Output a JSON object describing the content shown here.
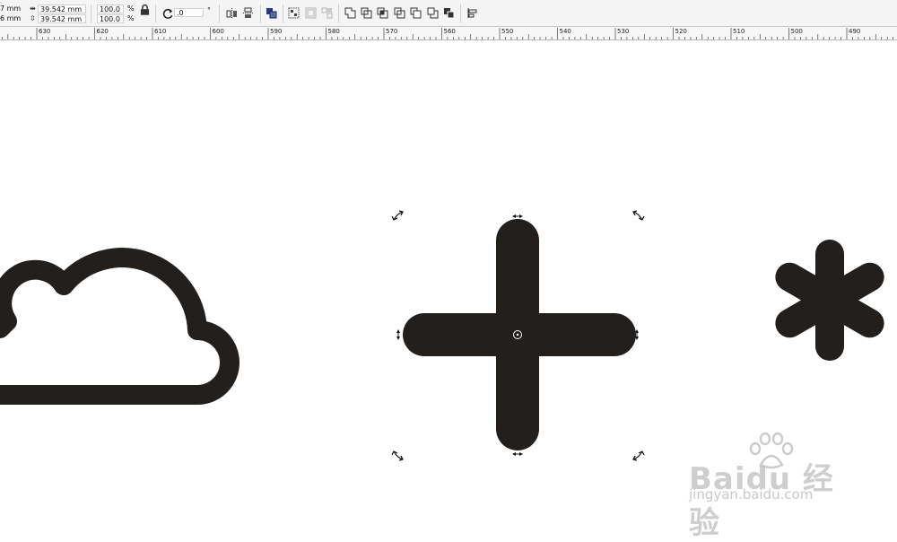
{
  "propbar": {
    "x_partial": "7 mm",
    "y_partial": "6 mm",
    "width_value": "39.542 mm",
    "height_value": "39.542 mm",
    "scale_x": "100.0",
    "scale_y": "100.0",
    "pct_symbol_1": "%",
    "pct_symbol_2": "%",
    "angle_value": ".0",
    "degree_symbol": "°"
  },
  "ruler": {
    "labels": [
      "630",
      "620",
      "610",
      "600",
      "590",
      "580",
      "570",
      "560",
      "550",
      "540",
      "530",
      "520",
      "510",
      "500",
      "490"
    ]
  },
  "watermark": {
    "brand": "Baidu 经验",
    "url": "jingyan.baidu.com"
  },
  "icons": {
    "lock": "lock-icon",
    "rotate": "rotate-icon",
    "mirror_h": "mirror-horizontal-icon",
    "mirror_v": "mirror-vertical-icon",
    "arrange": "arrange-icon",
    "group": "group-icon",
    "ungroup": "ungroup-icon",
    "ungroup_all": "ungroup-all-icon",
    "weld": "weld-icon",
    "trim": "trim-icon",
    "intersect": "intersect-icon",
    "simplify": "simplify-icon",
    "front_minus_back": "front-minus-back-icon",
    "back_minus_front": "back-minus-front-icon",
    "boundary": "boundary-icon",
    "align": "align-icon"
  },
  "colors": {
    "shape_fill": "#231f1c",
    "toolbar_bg": "#f4f4f4",
    "ruler_bg": "#f7f7f7"
  }
}
